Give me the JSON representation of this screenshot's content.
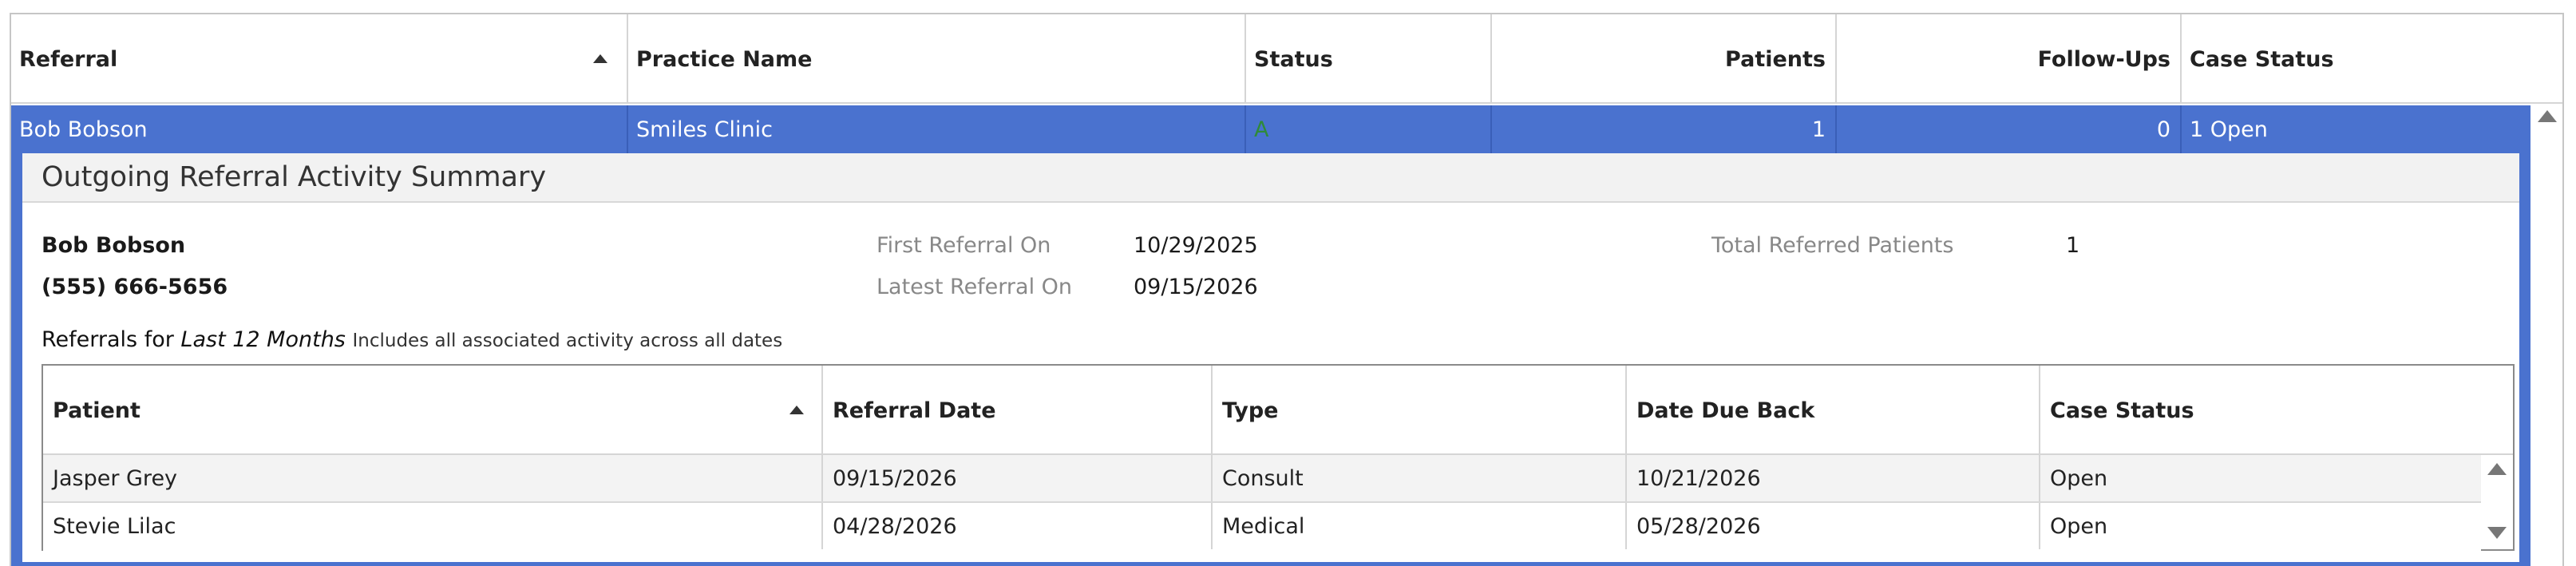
{
  "main_table": {
    "columns": [
      {
        "label": "Referral",
        "sorted": "ascending"
      },
      {
        "label": "Practice Name"
      },
      {
        "label": "Status"
      },
      {
        "label": "Patients"
      },
      {
        "label": "Follow-Ups"
      },
      {
        "label": "Case Status"
      }
    ],
    "selected_row": {
      "referral": "Bob Bobson",
      "practice_name": "Smiles Clinic",
      "status": "A",
      "patients": "1",
      "follow_ups": "0",
      "case_status": "1 Open"
    }
  },
  "summary": {
    "title": "Outgoing Referral Activity Summary",
    "name": "Bob Bobson",
    "phone": "(555) 666-5656",
    "first_referral_label": "First Referral On",
    "first_referral_value": "10/29/2025",
    "latest_referral_label": "Latest Referral On",
    "latest_referral_value": "09/15/2026",
    "total_patients_label": "Total Referred Patients",
    "total_patients_value": "1",
    "referrals_for_prefix": "Referrals for",
    "referrals_for_period": "Last 12 Months",
    "referrals_for_note": "Includes all associated activity across all dates"
  },
  "referral_table": {
    "columns": [
      {
        "label": "Patient",
        "sorted": "ascending"
      },
      {
        "label": "Referral Date"
      },
      {
        "label": "Type"
      },
      {
        "label": "Date Due Back"
      },
      {
        "label": "Case Status"
      }
    ],
    "rows": [
      {
        "patient": "Jasper Grey",
        "referral_date": "09/15/2026",
        "type": "Consult",
        "date_due_back": "10/21/2026",
        "case_status": "Open"
      },
      {
        "patient": "Stevie Lilac",
        "referral_date": "04/28/2026",
        "type": "Medical",
        "date_due_back": "05/28/2026",
        "case_status": "Open"
      }
    ]
  },
  "icons": {
    "sort_ascending": "sort-ascending-icon",
    "scroll_up": "scroll-up-arrow-icon",
    "scroll_down": "scroll-down-arrow-icon"
  },
  "colors": {
    "selection_blue": "#4a72cf",
    "status_active_green": "#2f8a3a"
  }
}
